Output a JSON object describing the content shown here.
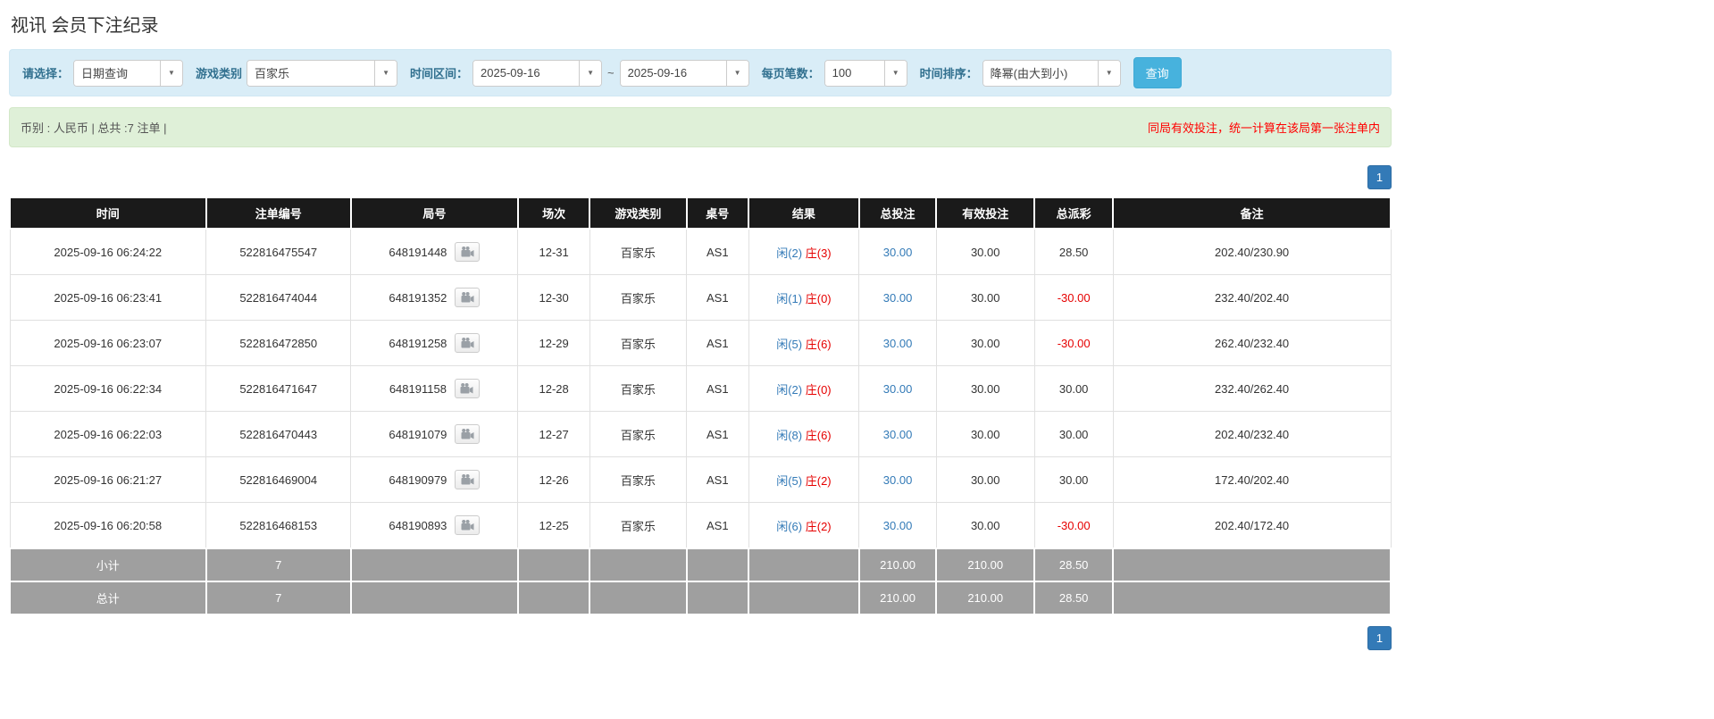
{
  "page": {
    "title": "视讯 会员下注纪录"
  },
  "filters": {
    "select_label": "请选择：",
    "select_value": "日期查询",
    "game_type_label": "游戏类别",
    "game_type_value": "百家乐",
    "time_range_label": "时间区间：",
    "date_from": "2025-09-16",
    "date_separator": "~",
    "date_to": "2025-09-16",
    "page_size_label": "每页笔数：",
    "page_size_value": "100",
    "sort_label": "时间排序：",
    "sort_value": "降幂(由大到小)",
    "search_button": "查询"
  },
  "summary": {
    "left_text": "币别 : 人民币 | 总共 :7 注单 |",
    "right_note": "同局有效投注，统一计算在该局第一张注单内"
  },
  "pagination": {
    "page": "1"
  },
  "icons": {
    "caret_down": "▼",
    "replay_icon_name": "video-camera-icon"
  },
  "colors": {
    "filter_bg": "#d9edf7",
    "summary_bg": "#dff0d8",
    "filter_label_blue": "#31708f",
    "search_button_blue": "#47b2dd",
    "pagination_blue": "#337ab7",
    "table_header_bg": "#1a1a1a",
    "table_footer_bg": "#9f9f9f",
    "link_blue": "#337ab7",
    "negative_red": "#e60000",
    "note_red": "#ff0000"
  },
  "table": {
    "headers": [
      "时间",
      "注单编号",
      "局号",
      "场次",
      "游戏类别",
      "桌号",
      "结果",
      "总投注",
      "有效投注",
      "总派彩",
      "备注"
    ],
    "rows": [
      {
        "time": "2025-09-16 06:24:22",
        "bet_id": "522816475547",
        "round_id": "648191448",
        "session": "12-31",
        "game": "百家乐",
        "table_no": "AS1",
        "result_player": "闲(2)",
        "result_banker": "庄(3)",
        "total_bet": "30.00",
        "valid_bet": "30.00",
        "payout": "28.50",
        "remark": "202.40/230.90"
      },
      {
        "time": "2025-09-16 06:23:41",
        "bet_id": "522816474044",
        "round_id": "648191352",
        "session": "12-30",
        "game": "百家乐",
        "table_no": "AS1",
        "result_player": "闲(1)",
        "result_banker": "庄(0)",
        "total_bet": "30.00",
        "valid_bet": "30.00",
        "payout": "-30.00",
        "remark": "232.40/202.40"
      },
      {
        "time": "2025-09-16 06:23:07",
        "bet_id": "522816472850",
        "round_id": "648191258",
        "session": "12-29",
        "game": "百家乐",
        "table_no": "AS1",
        "result_player": "闲(5)",
        "result_banker": "庄(6)",
        "total_bet": "30.00",
        "valid_bet": "30.00",
        "payout": "-30.00",
        "remark": "262.40/232.40"
      },
      {
        "time": "2025-09-16 06:22:34",
        "bet_id": "522816471647",
        "round_id": "648191158",
        "session": "12-28",
        "game": "百家乐",
        "table_no": "AS1",
        "result_player": "闲(2)",
        "result_banker": "庄(0)",
        "total_bet": "30.00",
        "valid_bet": "30.00",
        "payout": "30.00",
        "remark": "232.40/262.40"
      },
      {
        "time": "2025-09-16 06:22:03",
        "bet_id": "522816470443",
        "round_id": "648191079",
        "session": "12-27",
        "game": "百家乐",
        "table_no": "AS1",
        "result_player": "闲(8)",
        "result_banker": "庄(6)",
        "total_bet": "30.00",
        "valid_bet": "30.00",
        "payout": "30.00",
        "remark": "202.40/232.40"
      },
      {
        "time": "2025-09-16 06:21:27",
        "bet_id": "522816469004",
        "round_id": "648190979",
        "session": "12-26",
        "game": "百家乐",
        "table_no": "AS1",
        "result_player": "闲(5)",
        "result_banker": "庄(2)",
        "total_bet": "30.00",
        "valid_bet": "30.00",
        "payout": "30.00",
        "remark": "172.40/202.40"
      },
      {
        "time": "2025-09-16 06:20:58",
        "bet_id": "522816468153",
        "round_id": "648190893",
        "session": "12-25",
        "game": "百家乐",
        "table_no": "AS1",
        "result_player": "闲(6)",
        "result_banker": "庄(2)",
        "total_bet": "30.00",
        "valid_bet": "30.00",
        "payout": "-30.00",
        "remark": "202.40/172.40"
      }
    ],
    "subtotal": {
      "label": "小计",
      "count": "7",
      "total_bet": "210.00",
      "valid_bet": "210.00",
      "payout": "28.50"
    },
    "total": {
      "label": "总计",
      "count": "7",
      "total_bet": "210.00",
      "valid_bet": "210.00",
      "payout": "28.50"
    }
  }
}
